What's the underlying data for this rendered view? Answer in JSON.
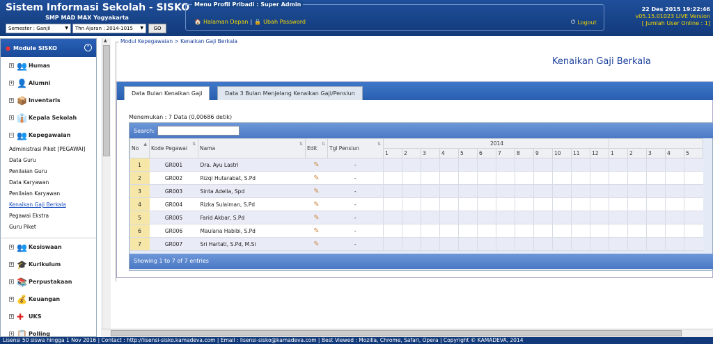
{
  "header": {
    "title": "Sistem Informasi Sekolah - SISKO",
    "school": "SMP MAD MAX Yogyakarta",
    "semester": "Semester : Ganjil",
    "tahun_ajaran": "Thn Ajaran : 2014-1015",
    "go_label": "GO",
    "menu_profil_legend": "Menu Profil Pribadi : Super Admin",
    "halaman_depan": "Halaman Depan",
    "ubah_password": "Ubah Password",
    "logout": "Logout",
    "datetime": "22 Des 2015 19:22:46",
    "version": "v05.15.01023 LIVE Version",
    "online": "[ Jumlah User Online : 1]"
  },
  "sidebar": {
    "title": "Module SISKO",
    "cats_top": [
      {
        "label": "Humas",
        "icon": "people-icon"
      },
      {
        "label": "Alumni",
        "icon": "alumni-icon"
      },
      {
        "label": "Inventaris",
        "icon": "inventory-icon"
      },
      {
        "label": "Kepala Sekolah",
        "icon": "principal-icon"
      }
    ],
    "kepegawaian": {
      "label": "Kepegawaian",
      "items": [
        "Administrasi Piket [PEGAWAI]",
        "Data Guru",
        "Penilaian Guru",
        "Data Karyawan",
        "Penilaian Karyawan",
        "Kenaikan Gaji Berkala",
        "Pegawai Ekstra",
        "Guru Piket"
      ]
    },
    "cats_bottom": [
      {
        "label": "Kesiswaan",
        "icon": "students-icon"
      },
      {
        "label": "Kurikulum",
        "icon": "curriculum-icon"
      },
      {
        "label": "Perpustakaan",
        "icon": "library-icon"
      },
      {
        "label": "Keuangan",
        "icon": "money-icon"
      },
      {
        "label": "UKS",
        "icon": "health-icon"
      },
      {
        "label": "Polling",
        "icon": "polling-icon"
      }
    ]
  },
  "main": {
    "breadcrumb": "Modul Kepegawaian > Kenaikan Gaji Berkala",
    "page_title": "Kenaikan Gaji Berkala",
    "tabs": [
      "Data Bulan Kenaikan Gaji",
      "Data 3 Bulan Menjelang Kenaikan Gaji/Pensiun"
    ],
    "menemukan": "Menemukan : 7 Data (0,00686 detik)",
    "search_label": "Search:",
    "columns": {
      "no": "No",
      "kode": "Kode Pegawai",
      "nama": "Nama",
      "edit": "Edit",
      "tgl": "Tgl Pensiun",
      "year": "2014"
    },
    "months": [
      "1",
      "2",
      "3",
      "4",
      "5",
      "6",
      "7",
      "8",
      "9",
      "10",
      "11",
      "12",
      "1",
      "2",
      "3",
      "4",
      "5"
    ],
    "rows": [
      {
        "no": "1",
        "kode": "GR001",
        "nama": "Dra. Ayu Lastri",
        "tgl": "-"
      },
      {
        "no": "2",
        "kode": "GR002",
        "nama": "Rizqi Hutarabat, S.Pd",
        "tgl": "-"
      },
      {
        "no": "3",
        "kode": "GR003",
        "nama": "Sinta Adelia, Spd",
        "tgl": "-"
      },
      {
        "no": "4",
        "kode": "GR004",
        "nama": "Rizka Sulaiman, S.Pd",
        "tgl": "-"
      },
      {
        "no": "5",
        "kode": "GR005",
        "nama": "Farid Akbar, S.Pd",
        "tgl": "-"
      },
      {
        "no": "6",
        "kode": "GR006",
        "nama": "Maulana Habibi, S.Pd",
        "tgl": "-"
      },
      {
        "no": "7",
        "kode": "GR007",
        "nama": "Sri Hartati, S.Pd, M.Si",
        "tgl": "-"
      }
    ],
    "showing": "Showing 1 to 7 of 7 entries"
  },
  "footer": "Lisensi 50 siswa hingga 1 Nov 2016   |   Contact : http://lisensi-sisko.kamadeva.com   |   Email : lisensi-sisko@kamadeva.com   |   Best Viewed : Mozilla, Chrome, Safari, Opera   |   Copyright © KAMADEVA, 2014"
}
